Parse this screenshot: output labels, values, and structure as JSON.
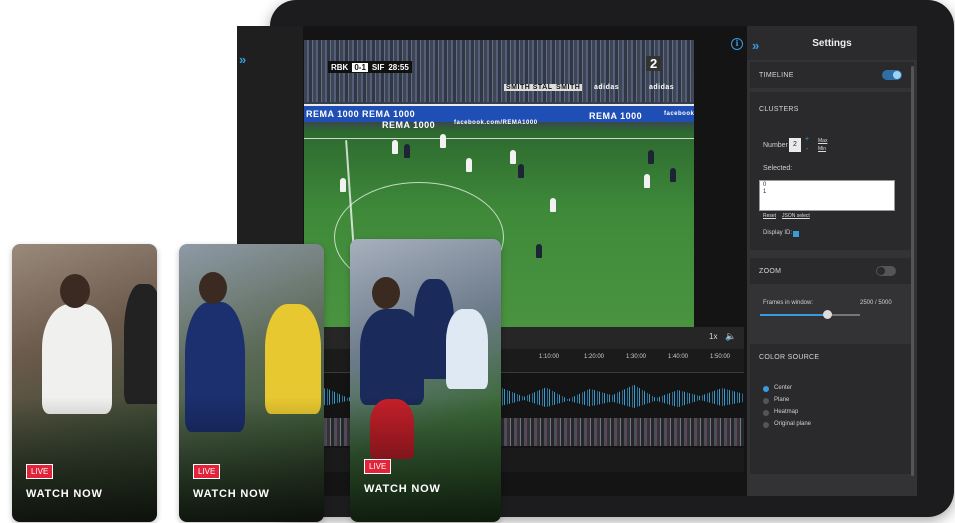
{
  "video": {
    "scoreboard": {
      "home": "RBK",
      "score": "0-1",
      "away": "SIF",
      "clock": "28:55"
    },
    "jersey_number": "2",
    "ads": [
      "REMA 1000",
      "REMA 1000",
      "REMA 1000",
      "facebook.com/REMA1000",
      "REMA 1000",
      "facebook"
    ],
    "top_ads": [
      "SMITH STAL",
      "SMITH",
      "adidas",
      "adidas"
    ]
  },
  "controls": {
    "speed": "1x"
  },
  "timeline": {
    "ticks": [
      "1:10:00",
      "1:20:00",
      "1:30:00",
      "1:40:00",
      "1:50:00"
    ]
  },
  "settings": {
    "title": "Settings",
    "timeline": {
      "label": "TIMELINE",
      "enabled": true
    },
    "clusters": {
      "label": "CLUSTERS",
      "number_label": "Number",
      "number_value": "2",
      "plus": "+",
      "minus": "-",
      "max": "Max",
      "min": "Min",
      "selected_label": "Selected:",
      "selected_values": [
        "0",
        "1"
      ],
      "reset": "Reset",
      "json_select": "JSON select",
      "display_ids": "Display ID:"
    },
    "zoom": {
      "label": "ZOOM",
      "enabled": false,
      "frames_label": "Frames in window:",
      "frames_value": "2500 / 5000",
      "fraction": 0.5
    },
    "color_source": {
      "label": "COLOR SOURCE",
      "options": [
        "Center",
        "Plane",
        "Heatmap",
        "Original plane"
      ],
      "selected": "Center"
    }
  },
  "cards": [
    {
      "live": "LIVE",
      "cta": "WATCH NOW"
    },
    {
      "live": "LIVE",
      "cta": "WATCH NOW"
    },
    {
      "live": "LIVE",
      "cta": "WATCH NOW"
    }
  ],
  "colors": {
    "accent": "#3a9bdc",
    "live": "#e2243a",
    "pitch": "#3f8a3a",
    "adboard": "#1f4fb5"
  },
  "icons": [
    "expand-left-icon",
    "expand-right-icon",
    "info-icon",
    "volume-icon",
    "toggle-on",
    "toggle-off"
  ]
}
